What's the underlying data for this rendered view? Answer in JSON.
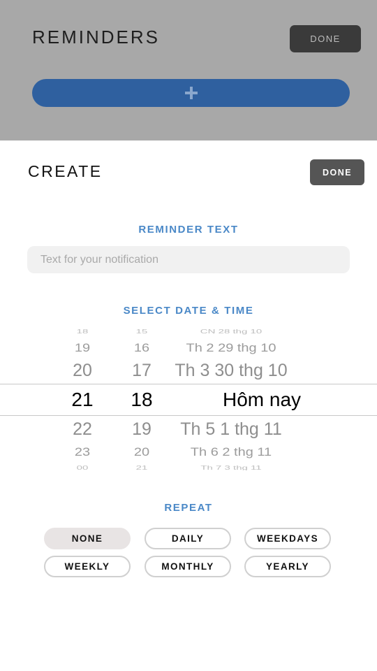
{
  "background_screen": {
    "title": "REMINDERS",
    "done_label": "DONE",
    "add_button_icon": "plus-icon"
  },
  "create_sheet": {
    "title": "CREATE",
    "done_label": "DONE",
    "reminder_text_label": "REMINDER TEXT",
    "reminder_text_value": "",
    "reminder_text_placeholder": "Text for your notification",
    "select_datetime_label": "SELECT DATE & TIME",
    "picker": {
      "rows": [
        {
          "hour": "18",
          "minute": "15",
          "date": "CN 28 thg 10"
        },
        {
          "hour": "19",
          "minute": "16",
          "date": "Th 2 29 thg 10"
        },
        {
          "hour": "20",
          "minute": "17",
          "date": "Th 3 30 thg 10"
        },
        {
          "hour": "21",
          "minute": "18",
          "date": "Hôm nay"
        },
        {
          "hour": "22",
          "minute": "19",
          "date": "Th 5 1 thg 11"
        },
        {
          "hour": "23",
          "minute": "20",
          "date": "Th 6 2 thg 11"
        },
        {
          "hour": "00",
          "minute": "21",
          "date": "Th 7 3 thg 11"
        }
      ],
      "selected": {
        "hour": "21",
        "minute": "18",
        "date": "Hôm nay"
      }
    },
    "repeat_label": "REPEAT",
    "repeat_options": [
      "NONE",
      "DAILY",
      "WEEKDAYS",
      "WEEKLY",
      "MONTHLY",
      "YEARLY"
    ],
    "repeat_selected": "NONE"
  },
  "colors": {
    "accent": "#4a88c7",
    "add_button": "#2f609f",
    "dim_overlay": "#a8a8a8"
  }
}
